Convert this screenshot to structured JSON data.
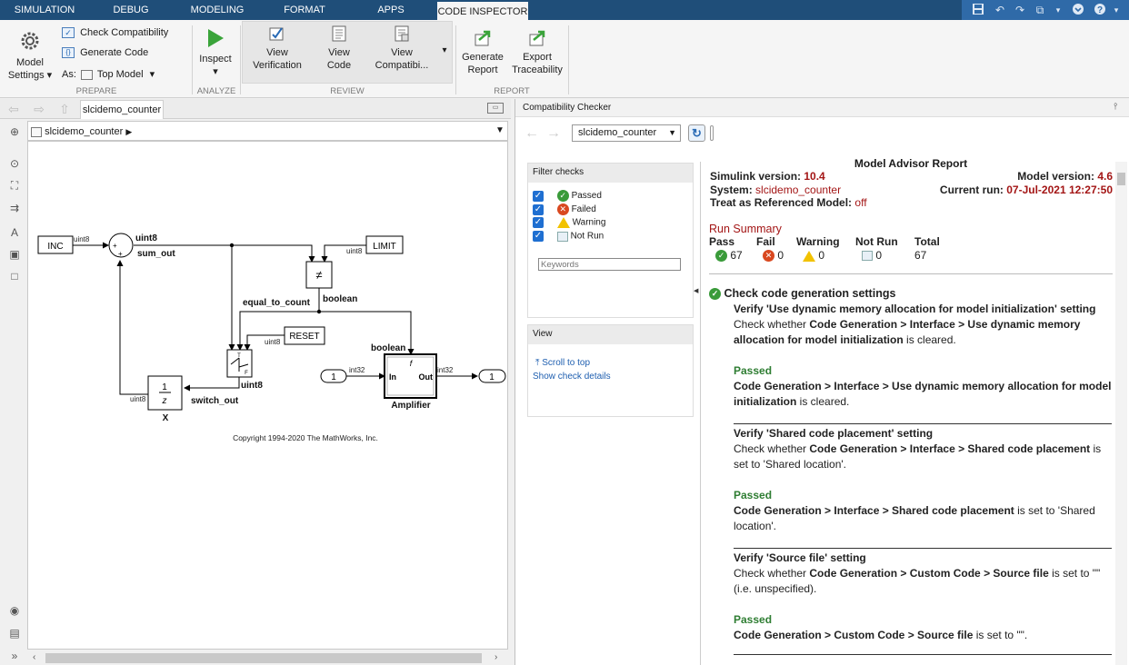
{
  "tabs": [
    "SIMULATION",
    "DEBUG",
    "MODELING",
    "FORMAT",
    "APPS",
    "CODE INSPECTOR"
  ],
  "active_tab_close": "×",
  "ribbon": {
    "model_settings": [
      "Model",
      "Settings"
    ],
    "check_compat": "Check Compatibility",
    "generate_code": "Generate Code",
    "as_label": "As:",
    "top_model": "Top Model",
    "inspect": "Inspect",
    "view_verification": [
      "View",
      "Verification"
    ],
    "view_code": [
      "View",
      "Code"
    ],
    "view_compat": [
      "View",
      "Compatibi..."
    ],
    "generate_report": [
      "Generate",
      "Report"
    ],
    "export_traceability": [
      "Export",
      "Traceability"
    ],
    "groups": {
      "prepare": "PREPARE",
      "analyze": "ANALYZE",
      "review": "REVIEW",
      "report": "REPORT"
    }
  },
  "left": {
    "tab_title": "slcidemo_counter",
    "breadcrumb": "slcidemo_counter",
    "diagram": {
      "blocks": {
        "inc": "INC",
        "limit": "LIMIT",
        "reset": "RESET",
        "in1": "1",
        "out1": "1",
        "ne": "≠",
        "delay_num": "1",
        "delay_den": "z",
        "amp_in": "In",
        "amp_out": "Out",
        "switch_t": "T",
        "switch_f": "F"
      },
      "labels": {
        "uint8_a": "uint8",
        "uint8_b": "uint8",
        "uint8_c": "uint8",
        "uint8_d": "uint8",
        "uint8_e": "uint8",
        "uint8_f": "uint8",
        "sum_out": "sum_out",
        "equal_to_count": "equal_to_count",
        "boolean_a": "boolean",
        "boolean_b": "boolean",
        "switch_out": "switch_out",
        "x": "X",
        "amplifier": "Amplifier",
        "int32_a": "int32",
        "int32_b": "int32",
        "copyright": "Copyright 1994-2020 The MathWorks, Inc."
      }
    }
  },
  "right": {
    "title": "Compatibility Checker",
    "model_select": "slcidemo_counter",
    "filter": {
      "title": "Filter checks",
      "items": [
        "Passed",
        "Failed",
        "Warning",
        "Not Run"
      ],
      "keywords_placeholder": "Keywords"
    },
    "view": {
      "title": "View",
      "scroll_top": "Scroll to top",
      "show_details": "Show check details"
    },
    "report": {
      "title": "Model Advisor Report",
      "simulink_version_label": "Simulink version:",
      "simulink_version": "10.4",
      "model_version_label": "Model version:",
      "model_version": "4.6",
      "system_label": "System:",
      "system": "slcidemo_counter",
      "current_run_label": "Current run:",
      "current_run": "07-Jul-2021 12:27:50",
      "treat_label": "Treat as Referenced Model:",
      "treat": "off",
      "run_summary": "Run Summary",
      "summary": [
        {
          "label": "Pass",
          "count": "67"
        },
        {
          "label": "Fail",
          "count": "0"
        },
        {
          "label": "Warning",
          "count": "0"
        },
        {
          "label": "Not Run",
          "count": "0"
        },
        {
          "label": "Total",
          "count": "67"
        }
      ],
      "section": "Check code generation settings",
      "checks": [
        {
          "title": "Verify 'Use dynamic memory allocation for model initialization' setting",
          "desc1": "Check whether ",
          "desc_b": "Code Generation > Interface > Use dynamic memory allocation for model initialization",
          "desc2": " is cleared.",
          "status": "Passed",
          "res_b": "Code Generation > Interface > Use dynamic memory allocation for model initialization",
          "res2": " is cleared."
        },
        {
          "title": "Verify 'Shared code placement' setting",
          "desc1": "Check whether ",
          "desc_b": "Code Generation > Interface > Shared code placement",
          "desc2": " is set to 'Shared location'.",
          "status": "Passed",
          "res_b": "Code Generation > Interface > Shared code placement",
          "res2": " is set to 'Shared location'."
        },
        {
          "title": "Verify 'Source file' setting",
          "desc1": "Check whether ",
          "desc_b": "Code Generation > Custom Code > Source file",
          "desc2": " is set to \"\" (i.e. unspecified).",
          "status": "Passed",
          "res_b": "Code Generation > Custom Code > Source file",
          "res2": " is set to \"\"."
        }
      ]
    }
  }
}
